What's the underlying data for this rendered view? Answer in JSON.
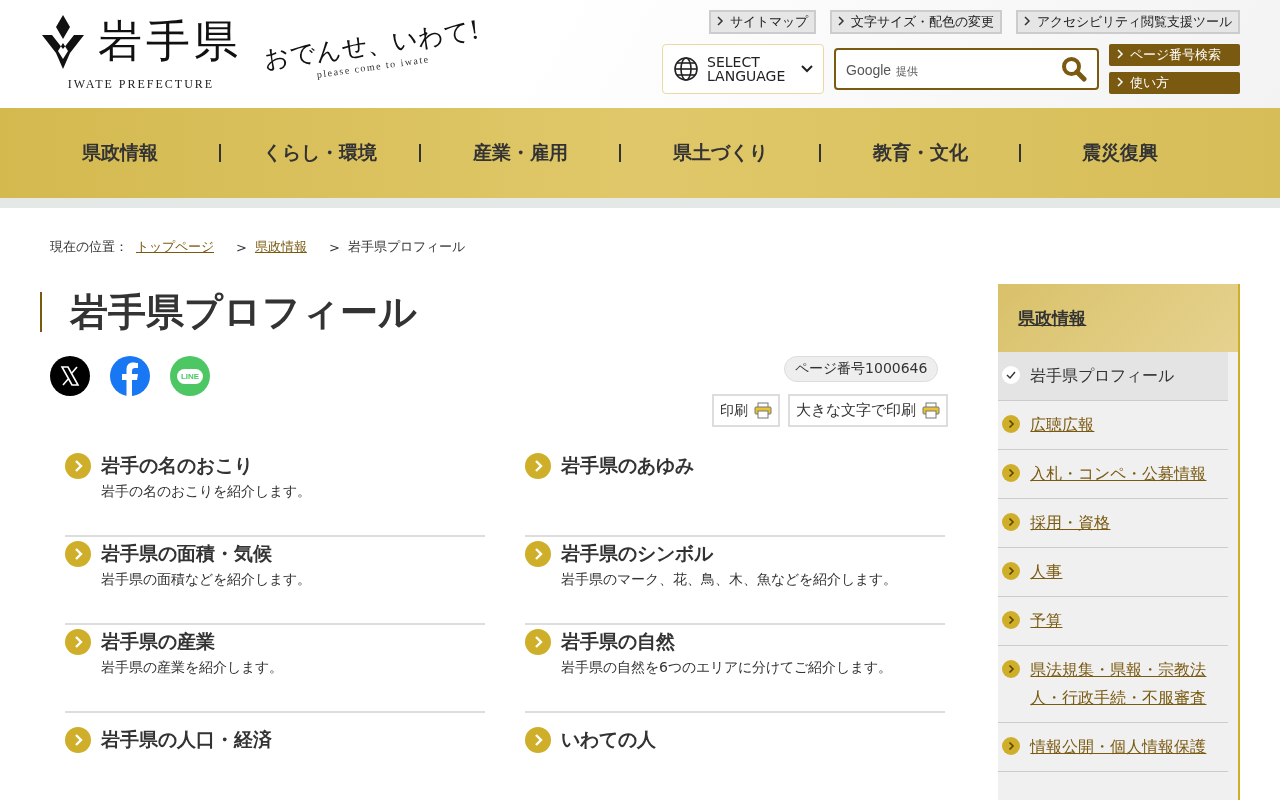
{
  "header": {
    "logo_text": "岩手県",
    "logo_subtitle": "IWATE PREFECTURE",
    "tagline": "おでんせ、いわて!",
    "tagline_sub": "please come to iwate",
    "utility_links": [
      "サイトマップ",
      "文字サイズ・配色の変更",
      "アクセシビリティ閲覧支援ツール"
    ],
    "language_selector": "SELECT LANGUAGE",
    "search": {
      "brand": "Google",
      "brand_note": "提供"
    },
    "page_links": [
      "ページ番号検索",
      "使い方"
    ]
  },
  "nav": [
    "県政情報",
    "くらし・環境",
    "産業・雇用",
    "県土づくり",
    "教育・文化",
    "震災復興"
  ],
  "breadcrumb": {
    "label": "現在の位置：",
    "separator": ">",
    "items": [
      {
        "text": "トップページ",
        "link": true
      },
      {
        "text": "県政情報",
        "link": true
      },
      {
        "text": "岩手県プロフィール",
        "link": false
      }
    ]
  },
  "title": "岩手県プロフィール",
  "share": [
    {
      "kind": "x"
    },
    {
      "kind": "facebook"
    },
    {
      "kind": "line",
      "label": "LINE"
    }
  ],
  "page_number": "ページ番号1000646",
  "print_buttons": [
    "印刷",
    "大きな文字で印刷"
  ],
  "topics": [
    {
      "title": "岩手の名のおこり",
      "description": "岩手の名のおこりを紹介します。"
    },
    {
      "title": "岩手県のあゆみ"
    },
    {
      "title": "岩手県の面積・気候",
      "description": "岩手県の面積などを紹介します。"
    },
    {
      "title": "岩手県のシンボル",
      "description": "岩手県のマーク、花、鳥、木、魚などを紹介します。"
    },
    {
      "title": "岩手県の産業",
      "description": "岩手県の産業を紹介します。"
    },
    {
      "title": "岩手県の自然",
      "description": "岩手県の自然を6つのエリアに分けてご紹介します。"
    },
    {
      "title": "岩手県の人口・経済"
    },
    {
      "title": "いわての人"
    }
  ],
  "sidebar": {
    "heading": "県政情報",
    "items": [
      {
        "label": "岩手県プロフィール",
        "selected": true
      },
      {
        "label": "広聴広報",
        "selected": false
      },
      {
        "label": "入札・コンペ・公募情報",
        "selected": false
      },
      {
        "label": "採用・資格",
        "selected": false
      },
      {
        "label": "人事",
        "selected": false
      },
      {
        "label": "予算",
        "selected": false
      },
      {
        "label": "県法規集・県報・宗教法人・行政手続・不服審査",
        "selected": false
      },
      {
        "label": "情報公開・個人情報保護",
        "selected": false
      }
    ]
  }
}
